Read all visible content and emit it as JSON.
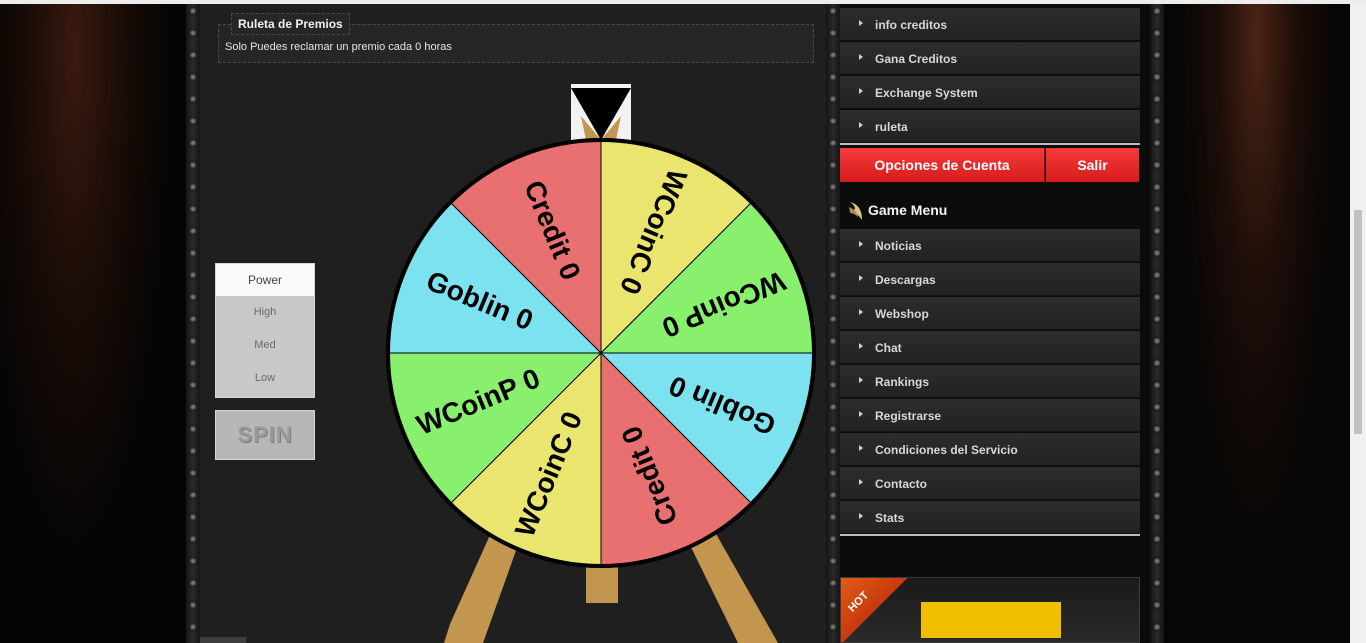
{
  "notice": {
    "title": "Ruleta de Premios",
    "text": "Solo Puedes reclamar un premio cada 0 horas"
  },
  "power": {
    "header": "Power",
    "options": [
      "High",
      "Med",
      "Low"
    ]
  },
  "spin_label": "SPIN",
  "wheel": {
    "segments": [
      {
        "label": "WCoinC 0",
        "color": "#e9e56e"
      },
      {
        "label": "WCoinP 0",
        "color": "#89f06e"
      },
      {
        "label": "Goblin 0",
        "color": "#7de2f0"
      },
      {
        "label": "Credit 0",
        "color": "#e87071"
      },
      {
        "label": "WCoinC 0",
        "color": "#e9e56e"
      },
      {
        "label": "WCoinP 0",
        "color": "#89f06e"
      },
      {
        "label": "Goblin 0",
        "color": "#7de2f0"
      },
      {
        "label": "Credit 0",
        "color": "#e87071"
      }
    ]
  },
  "sidebar": {
    "top_items": [
      "info creditos",
      "Gana Creditos",
      "Exchange System",
      "ruleta"
    ],
    "account_button": "Opciones de Cuenta",
    "logout_button": "Salir",
    "game_menu_title": "Game Menu",
    "game_items": [
      "Noticias",
      "Descargas",
      "Webshop",
      "Chat",
      "Rankings",
      "Registrarse",
      "Condiciones del Servicio",
      "Contacto",
      "Stats"
    ],
    "hot_label": "HOT"
  },
  "colors": {
    "accent_red": "#e52a2a",
    "panel_bg": "#1f1f1f",
    "stand": "#c2964e"
  }
}
